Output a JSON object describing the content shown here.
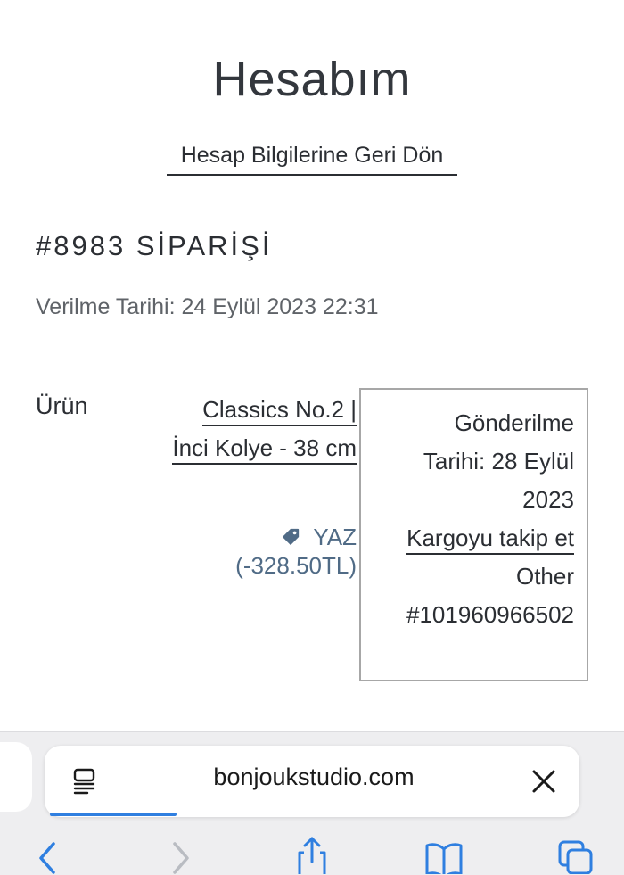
{
  "page": {
    "title": "Hesabım",
    "back_link": "Hesap Bilgilerine Geri Dön"
  },
  "order": {
    "title": "#8983 SİPARİŞİ",
    "date": "Verilme Tarihi: 24 Eylül 2023 22:31",
    "product_column_label": "Ürün",
    "product_name": "Classics No.2 | İnci Kolye - 38 cm",
    "discount_code": "YAZ",
    "discount_amount": "(-328.50TL)"
  },
  "tooltip": {
    "shipped_line_1": "Gönderilme",
    "shipped_line_2": "Tarihi: 28 Eylül",
    "shipped_line_3": "2023",
    "track_link": "Kargoyu takip et",
    "carrier": "Other",
    "tracking_number": "#101960966502"
  },
  "browser": {
    "url": "bonjoukstudio.com",
    "accent_color": "#2f7fe0",
    "icons": [
      "reader-icon",
      "close-icon",
      "back-chevron-icon",
      "forward-chevron-icon",
      "share-icon",
      "bookmarks-icon",
      "tabs-icon"
    ]
  }
}
